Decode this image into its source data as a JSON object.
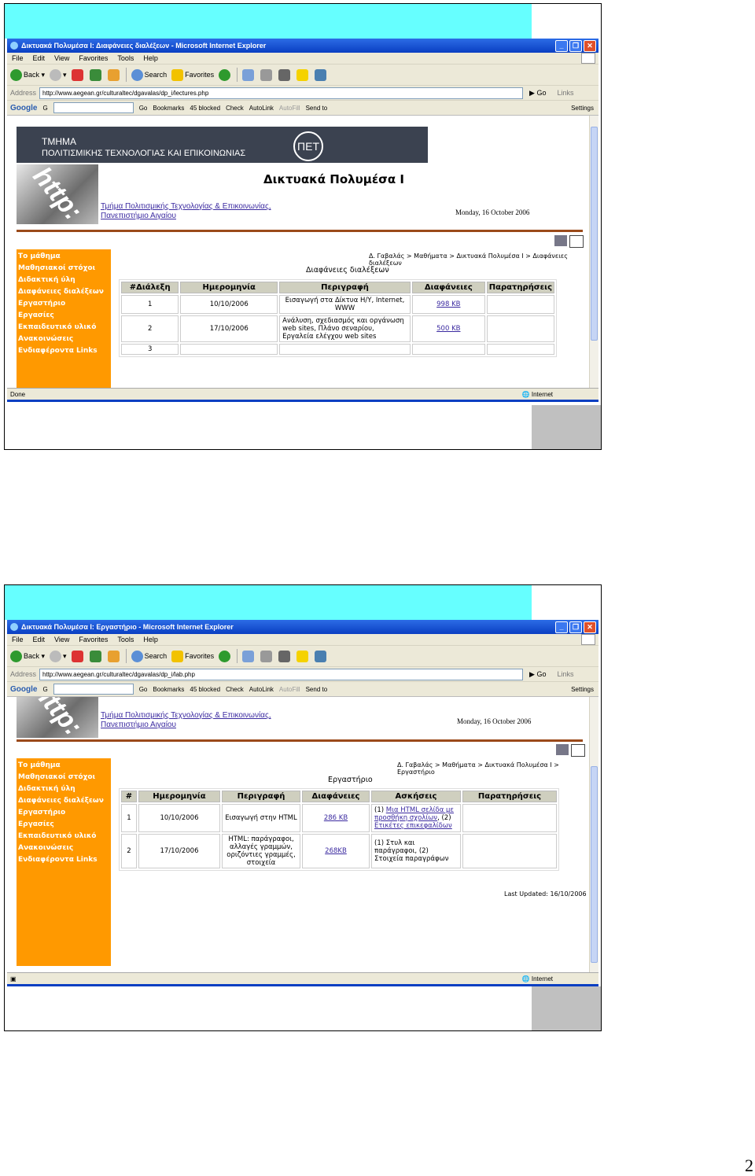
{
  "slide1": {
    "window_title": "Δικτυακά Πολυμέσα Ι: Διαφάνειες διαλέξεων - Microsoft Internet Explorer",
    "address": "http://www.aegean.gr/culturaltec/dgavalas/dp_i/lectures.php",
    "status": "Done",
    "zone": "Internet",
    "banner_line1": "ΤΜΗΜΑ",
    "banner_line2": "ΠΟΛΙΤΙΣΜΙΚΗΣ ΤΕΧΝΟΛΟΓΙΑΣ ΚΑΙ ΕΠΙΚΟΙΝΩΝΙΑΣ",
    "logo_text": "ΠΕΤ",
    "course_title": "Δικτυακά Πολυμέσα Ι",
    "dept_line1": "Τμήμα Πολιτισμικής Τεχνολογίας & Επικοινωνίας,",
    "dept_line2": "Πανεπιστήμιο Αιγαίου",
    "date": "Monday, 16 October 2006",
    "breadcrumb": "Δ. Γαβαλάς > Μαθήματα > Δικτυακά Πολυμέσα Ι > Διαφάνειες διαλέξεων",
    "page_title": "Διαφάνειες διαλέξεων",
    "headers": [
      "#Διάλεξη",
      "Ημερομηνία",
      "Περιγραφή",
      "Διαφάνειες",
      "Παρατηρήσεις"
    ],
    "rows": [
      {
        "num": "1",
        "date": "10/10/2006",
        "desc": "Εισαγωγή στα Δίκτυα Η/Υ, Internet, WWW",
        "slides": "998 KB",
        "notes": ""
      },
      {
        "num": "2",
        "date": "17/10/2006",
        "desc": "Ανάλυση, σχεδιασμός και οργάνωση web sites, Πλάνο σεναρίου, Εργαλεία ελέγχου web sites",
        "slides": "500 KB",
        "notes": ""
      },
      {
        "num": "3",
        "date": "",
        "desc": "",
        "slides": "",
        "notes": ""
      }
    ]
  },
  "slide2": {
    "window_title": "Δικτυακά Πολυμέσα Ι: Εργαστήριο - Microsoft Internet Explorer",
    "address": "http://www.aegean.gr/culturaltec/dgavalas/dp_i/lab.php",
    "zone": "Internet",
    "dept_line1": "Τμήμα Πολιτισμικής Τεχνολογίας & Επικοινωνίας,",
    "dept_line2": "Πανεπιστήμιο Αιγαίου",
    "date": "Monday, 16 October 2006",
    "breadcrumb": "Δ. Γαβαλάς > Μαθήματα > Δικτυακά Πολυμέσα Ι > Εργαστήριο",
    "page_title": "Εργαστήριο",
    "headers": [
      "#",
      "Ημερομηνία",
      "Περιγραφή",
      "Διαφάνειες",
      "Ασκήσεις",
      "Παρατηρήσεις"
    ],
    "rows": [
      {
        "num": "1",
        "date": "10/10/2006",
        "desc": "Εισαγωγή στην HTML",
        "slides": "286 KB",
        "ex_prefix1": "(1) ",
        "ex_link1": "Μια HTML σελίδα με προσθήκη σχολίων",
        "ex_mid": ", (2) ",
        "ex_link2": "Ετικέτες επικεφαλίδων",
        "notes": ""
      },
      {
        "num": "2",
        "date": "17/10/2006",
        "desc": "HTML: παράγραφοι, αλλαγές γραμμών, οριζόντιες γραμμές, στοιχεία",
        "slides": "268KB",
        "ex_text": "(1) Στυλ και παράγραφοι, (2) Στοιχεία παραγράφων",
        "notes": ""
      }
    ],
    "last_updated": "Last Updated: 16/10/2006"
  },
  "common": {
    "menu": [
      "File",
      "Edit",
      "View",
      "Favorites",
      "Tools",
      "Help"
    ],
    "toolbar": {
      "back": "Back",
      "search": "Search",
      "favorites": "Favorites"
    },
    "address_label": "Address",
    "go": "Go",
    "links": "Links",
    "google_bar": {
      "logo": "Google",
      "g": "G",
      "go": "Go",
      "bookmarks": "Bookmarks",
      "blocked": "45 blocked",
      "check": "Check",
      "autolink": "AutoLink",
      "autofill": "AutoFill",
      "sendto": "Send to",
      "settings": "Settings"
    },
    "sidebar": [
      "Το μάθημα",
      "Μαθησιακοί στόχοι",
      "Διδακτική ύλη",
      "Διαφάνειες διαλέξεων",
      "Εργαστήριο",
      "Εργασίες",
      "Εκπαιδευτικό υλικό",
      "Ανακοινώσεις",
      "Ενδιαφέροντα Links"
    ],
    "photo_text": "http:"
  },
  "page_number": "2",
  "colors": {
    "sidebar": "#ff9900",
    "header_bg": "#3b4250",
    "link": "#3b2aa0",
    "cyan": "#66ffff",
    "xp_blue": "#0a3fc2"
  }
}
